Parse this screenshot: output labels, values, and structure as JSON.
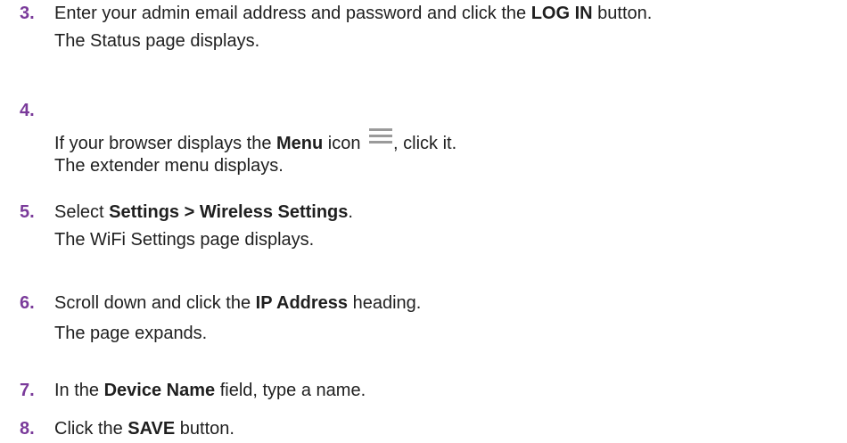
{
  "steps": [
    {
      "number": "3.",
      "line1": {
        "pre": "Enter your admin email address and password and click the ",
        "bold": "LOG IN",
        "post": " button."
      },
      "result": "The Status page displays."
    },
    {
      "number": "4.",
      "line1": {
        "pre": "If your browser displays the ",
        "bold": "Menu",
        "mid": " icon ",
        "icon": "hamburger-menu-icon",
        "post": ", click it."
      },
      "result": "The extender menu displays."
    },
    {
      "number": "5.",
      "line1": {
        "pre": "Select ",
        "bold": "Settings > Wireless Settings",
        "post": "."
      },
      "result": "The WiFi Settings page displays."
    },
    {
      "number": "6.",
      "line1": {
        "pre": "Scroll down and click the ",
        "bold": "IP Address",
        "post": " heading."
      },
      "result": "The page expands."
    },
    {
      "number": "7.",
      "line1": {
        "pre": "In the ",
        "bold": "Device Name",
        "post": " field, type a name."
      }
    },
    {
      "number": "8.",
      "line1": {
        "pre": "Click the ",
        "bold": "SAVE",
        "post": " button."
      }
    }
  ],
  "colors": {
    "step_number": "#7a3a9a",
    "text": "#1f1f1f",
    "icon": "#9a9a9a"
  }
}
